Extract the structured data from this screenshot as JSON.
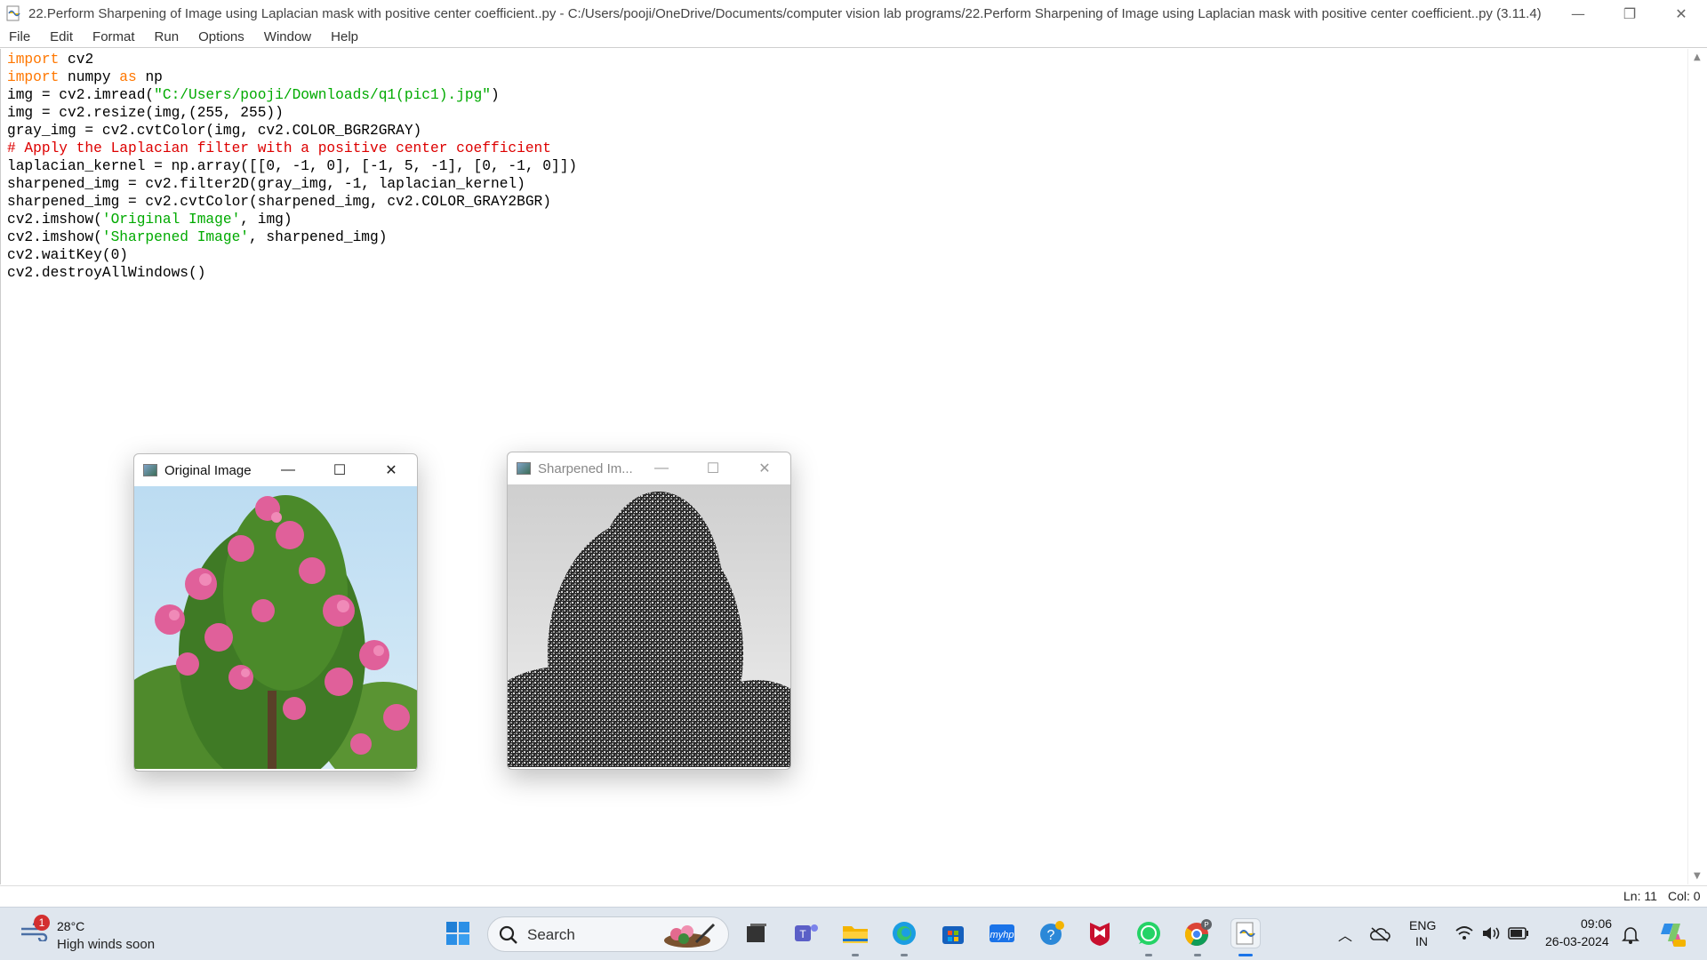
{
  "window": {
    "title": "22.Perform Sharpening of Image using Laplacian mask with positive center coefficient..py - C:/Users/pooji/OneDrive/Documents/computer vision lab programs/22.Perform Sharpening of Image using Laplacian mask with positive center coefficient..py (3.11.4)",
    "minimize_glyph": "—",
    "restore_glyph": "❐",
    "close_glyph": "✕"
  },
  "menu": [
    "File",
    "Edit",
    "Format",
    "Run",
    "Options",
    "Window",
    "Help"
  ],
  "code": [
    [
      {
        "t": "import",
        "c": "kw"
      },
      {
        "t": " cv2",
        "c": ""
      }
    ],
    [
      {
        "t": "import",
        "c": "kw"
      },
      {
        "t": " numpy ",
        "c": ""
      },
      {
        "t": "as",
        "c": "kw"
      },
      {
        "t": " np",
        "c": ""
      }
    ],
    [
      {
        "t": "img = cv2.imread(",
        "c": ""
      },
      {
        "t": "\"C:/Users/pooji/Downloads/q1(pic1).jpg\"",
        "c": "str"
      },
      {
        "t": ")",
        "c": ""
      }
    ],
    [
      {
        "t": "img = cv2.resize(img,(255, 255))",
        "c": ""
      }
    ],
    [
      {
        "t": "gray_img = cv2.cvtColor(img, cv2.COLOR_BGR2GRAY)",
        "c": ""
      }
    ],
    [
      {
        "t": "# Apply the Laplacian filter with a positive center coefficient",
        "c": "cmt"
      }
    ],
    [
      {
        "t": "laplacian_kernel = np.array([[0, -1, 0], [-1, 5, -1], [0, -1, 0]])",
        "c": ""
      }
    ],
    [
      {
        "t": "sharpened_img = cv2.filter2D(gray_img, -1, laplacian_kernel)",
        "c": ""
      }
    ],
    [
      {
        "t": "sharpened_img = cv2.cvtColor(sharpened_img, cv2.COLOR_GRAY2BGR)",
        "c": ""
      }
    ],
    [
      {
        "t": "cv2.imshow(",
        "c": ""
      },
      {
        "t": "'Original Image'",
        "c": "str"
      },
      {
        "t": ", img)",
        "c": ""
      }
    ],
    [
      {
        "t": "cv2.imshow(",
        "c": ""
      },
      {
        "t": "'Sharpened Image'",
        "c": "str"
      },
      {
        "t": ", sharpened_img)",
        "c": ""
      }
    ],
    [
      {
        "t": "cv2.waitKey(0)",
        "c": ""
      }
    ],
    [
      {
        "t": "cv2.destroyAllWindows()",
        "c": ""
      }
    ]
  ],
  "status": {
    "line": "Ln: 11",
    "col": "Col: 0"
  },
  "image_windows": {
    "original": {
      "title": "Original Image"
    },
    "sharpened": {
      "title": "Sharpened Im..."
    }
  },
  "taskbar": {
    "weather": {
      "badge": "1",
      "temp": "28°C",
      "condition": "High winds soon"
    },
    "search_label": "Search",
    "apps": [
      "start-icon",
      "search-icon",
      "file-explorer-icon",
      "teams-icon",
      "folder-icon",
      "edge-icon",
      "store-icon",
      "hp-icon",
      "copilot-icon",
      "mcafee-icon",
      "whatsapp-icon",
      "chrome-icon",
      "python-idle-icon"
    ],
    "tray": {
      "lang_top": "ENG",
      "lang_bottom": "IN",
      "time": "09:06",
      "date": "26-03-2024"
    }
  },
  "colors": {
    "keyword": "#ff7700",
    "string": "#00aa00",
    "comment": "#dd0000",
    "taskbar": "#dfe6ee"
  }
}
